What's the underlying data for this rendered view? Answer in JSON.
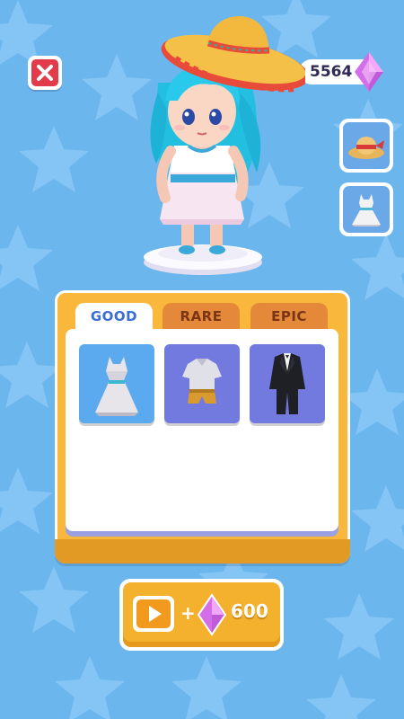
{
  "currency": {
    "gems": "5564"
  },
  "tabs": [
    {
      "label": "GOOD",
      "active": true
    },
    {
      "label": "RARE",
      "active": false
    },
    {
      "label": "EPIC",
      "active": false
    }
  ],
  "items": [
    {
      "icon": "white-dress-icon"
    },
    {
      "icon": "shirt-shorts-icon"
    },
    {
      "icon": "black-suit-icon"
    }
  ],
  "side_slots": [
    {
      "icon": "straw-hat-icon"
    },
    {
      "icon": "dress-icon"
    }
  ],
  "reward": {
    "plus": "+",
    "amount": "600",
    "icon": "video-ad-icon"
  },
  "colors": {
    "background": "#6cb6ee",
    "panel": "#f9b83c",
    "tab_active_text": "#3a6ed4",
    "tab_inactive": "#e4883a",
    "gem": "#e88cf0",
    "close": "#e23b4a"
  }
}
